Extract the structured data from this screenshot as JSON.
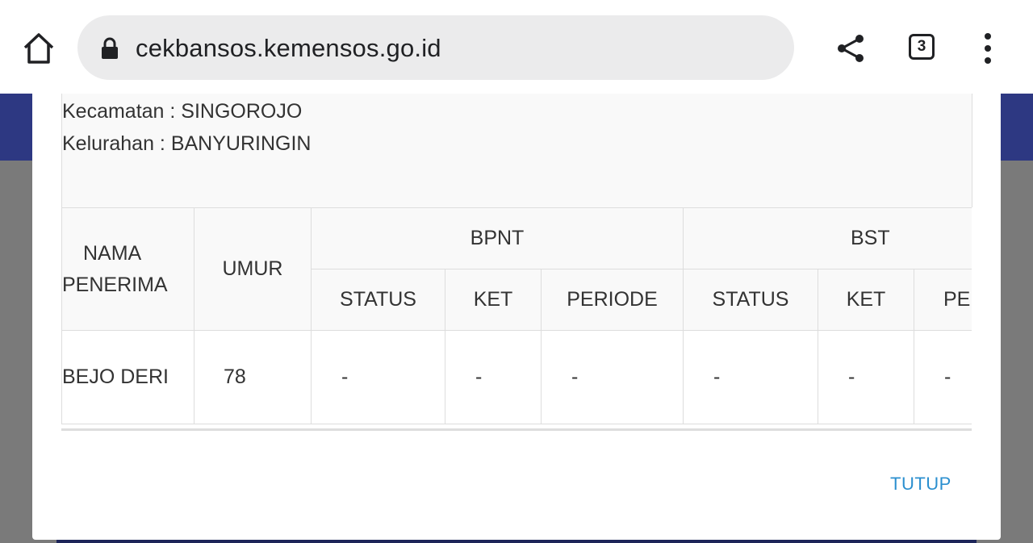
{
  "browser": {
    "url": "cekbansos.kemensos.go.id",
    "tab_count": "3"
  },
  "location": {
    "kecamatan": "Kecamatan : SINGOROJO",
    "kelurahan": "Kelurahan : BANYURINGIN"
  },
  "table": {
    "headers": {
      "nama": [
        "NAMA",
        "PENERIMA"
      ],
      "umur": "UMUR",
      "group1": "BPNT",
      "group2": "BST",
      "sub": [
        "STATUS",
        "KET",
        "PERIODE",
        "STATUS",
        "KET",
        "PERIODE"
      ]
    },
    "rows": [
      {
        "nama": "BEJO DERI",
        "umur": "78",
        "cells": [
          "-",
          "-",
          "-",
          "-",
          "-",
          "-"
        ]
      }
    ]
  },
  "modal": {
    "close_label": "TUTUP"
  },
  "colors": {
    "accent": "#2b8fcf",
    "header_bg": "#2d3882"
  }
}
